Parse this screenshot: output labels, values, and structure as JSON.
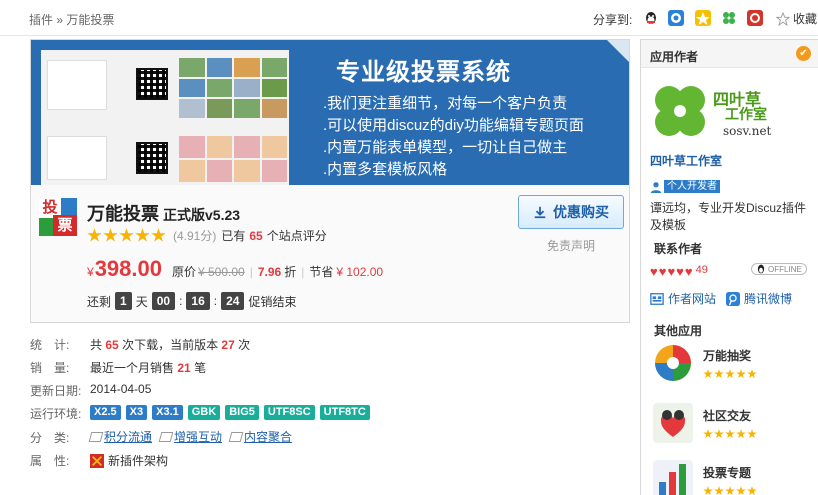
{
  "breadcrumb": {
    "root": "插件",
    "sep": "»",
    "current": "万能投票"
  },
  "share": {
    "label": "分享到:",
    "icons": [
      "qq-icon",
      "qzone-icon",
      "tencent-weibo-icon",
      "clover-icon",
      "renren-icon"
    ],
    "favorite_label": "收藏"
  },
  "banner": {
    "title": "专业级投票系统",
    "lines": [
      ".我们更注重细节，对每一个客户负责",
      ".可以使用discuz的diy功能编辑专题页面",
      ".内置万能表单模型，一切让自己做主",
      ".内置多套模板风格"
    ]
  },
  "plugin": {
    "logo_text_top": "投",
    "logo_text_bottom": "票",
    "name": "万能投票",
    "edition": "正式版v5.23",
    "rating": 4.91,
    "score_text": "(4.91分)",
    "rated_prefix": "已有",
    "rated_count": "65",
    "rated_suffix": "个站点评分"
  },
  "pricing": {
    "currency": "¥",
    "price": "398.00",
    "orig_label": "原价",
    "orig_price": "¥ 500.00",
    "discount": "7.96",
    "discount_suffix": "折",
    "save_label": "节省",
    "save_value": "¥ 102.00"
  },
  "countdown": {
    "prefix": "还剩",
    "days": "1",
    "day_label": "天",
    "hours": "00",
    "minutes": "16",
    "seconds": "24",
    "suffix": "促销结束"
  },
  "buy": {
    "label": "优惠购买",
    "disclaimer": "免责声明"
  },
  "info": {
    "stats_label": "统　计:",
    "stats_a": "共",
    "downloads": "65",
    "stats_b": "次下载，当前版本",
    "version_downloads": "27",
    "stats_c": "次",
    "sales_label": "销　量:",
    "sales_a": "最近一个月销售",
    "sales_count": "21",
    "sales_b": "笔",
    "update_label": "更新日期:",
    "update_date": "2014-04-05",
    "env_label": "运行环境:",
    "env_tags": [
      {
        "text": "X2.5",
        "color": "#2d7cc8"
      },
      {
        "text": "X3",
        "color": "#2d7cc8"
      },
      {
        "text": "X3.1",
        "color": "#2d7cc8"
      },
      {
        "text": "GBK",
        "color": "#1aae9a"
      },
      {
        "text": "BIG5",
        "color": "#1aae9a"
      },
      {
        "text": "UTF8SC",
        "color": "#1aae9a"
      },
      {
        "text": "UTF8TC",
        "color": "#1aae9a"
      }
    ],
    "category_label": "分　类:",
    "categories": [
      "积分流通",
      "增强互动",
      "内容聚合"
    ],
    "attr_label": "属　性:",
    "attr_value": "新插件架构"
  },
  "sidebar": {
    "header": "应用作者",
    "author_logo_name": "四叶草",
    "author_logo_sub": "工作室",
    "author_logo_url": "sosv.net",
    "author_name": "四叶草工作室",
    "dev_badge": "个人开发者",
    "author_desc": "谭远均，专业开发Discuz插件及模板",
    "contact_title": "联系作者",
    "hearts_count": "49",
    "offline_label": "OFFLINE",
    "site_link": "作者网站",
    "weibo_link": "腾讯微博",
    "other_apps_title": "其他应用",
    "apps": [
      {
        "name": "万能抽奖",
        "color": "#f2a51a"
      },
      {
        "name": "社区交友",
        "color": "#e4e4e4"
      },
      {
        "name": "投票专题",
        "color": "#c8d7ea"
      }
    ]
  },
  "colors": {
    "accent": "#e4393c",
    "link": "#1e5fa8",
    "banner": "#2a6cb1"
  }
}
